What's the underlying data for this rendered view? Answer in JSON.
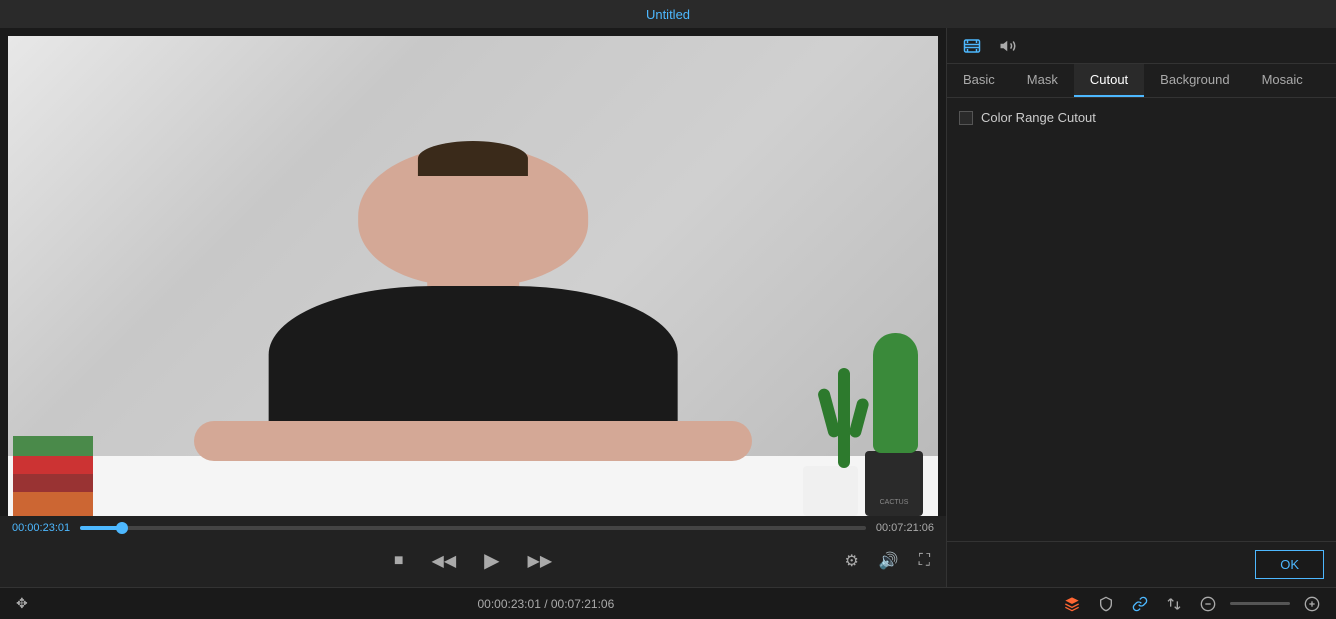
{
  "titleBar": {
    "title": "Untitled"
  },
  "videoPlayer": {
    "currentTime": "00:00:23:01",
    "totalTime": "00:07:21:06",
    "bottomTime": "00:00:23:01 / 00:07:21:06",
    "progressPercent": 5.3
  },
  "controls": {
    "stop": "■",
    "stepBack": "◀◀",
    "play": "▶",
    "stepForward": "▶▶"
  },
  "rightPanel": {
    "headerIcons": [
      "film-icon",
      "volume-icon"
    ],
    "tabs": [
      {
        "label": "Basic",
        "active": false
      },
      {
        "label": "Mask",
        "active": false
      },
      {
        "label": "Cutout",
        "active": true
      },
      {
        "label": "Background",
        "active": false
      },
      {
        "label": "Mosaic",
        "active": false
      }
    ],
    "cutout": {
      "colorRangeCutout": {
        "label": "Color Range Cutout",
        "checked": false
      }
    },
    "okButton": "OK"
  },
  "bottomBar": {
    "timeDisplay": "00:00:23:01 / 00:07:21:06",
    "tools": [
      {
        "name": "layers-icon",
        "label": "layers",
        "active": true
      },
      {
        "name": "shield-icon",
        "label": "shield"
      },
      {
        "name": "link-icon",
        "label": "link",
        "active": true
      },
      {
        "name": "swap-icon",
        "label": "swap"
      },
      {
        "name": "minus-circle-icon",
        "label": "minus-circle"
      },
      {
        "name": "zoom-slider",
        "label": "zoom"
      },
      {
        "name": "plus-circle-icon",
        "label": "plus-circle"
      }
    ]
  }
}
